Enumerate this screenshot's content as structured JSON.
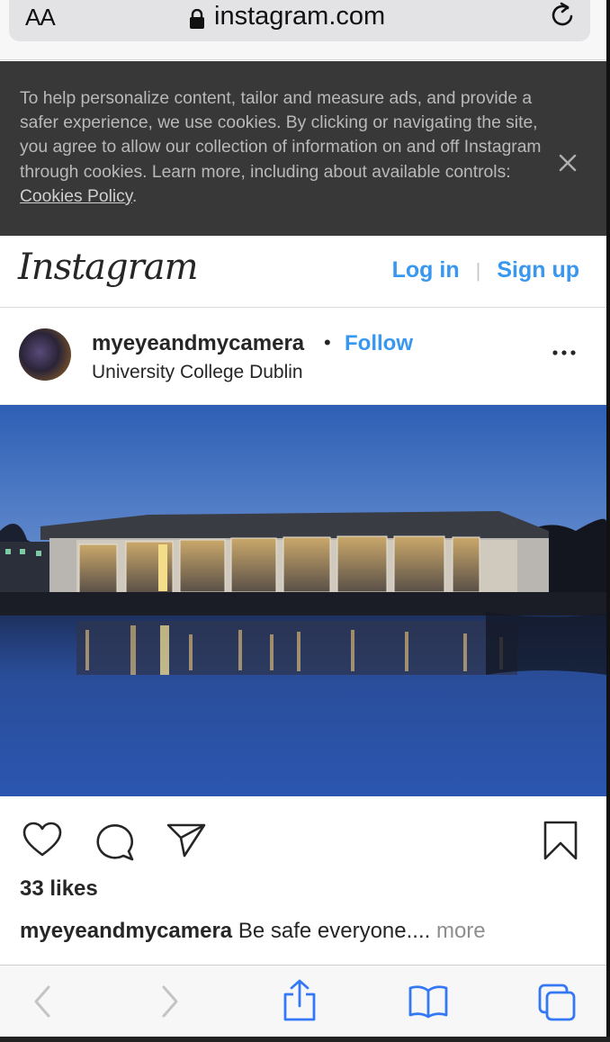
{
  "browser": {
    "text_size_label": "AA",
    "url": "instagram.com"
  },
  "cookie_banner": {
    "text": "To help personalize content, tailor and measure ads, and provide a safer experience, we use cookies. By clicking or navigating the site, you agree to allow our collection of information on and off Instagram through cookies. Learn more, including about available controls: ",
    "policy_link": "Cookies Policy",
    "suffix": "."
  },
  "header": {
    "logo": "Instagram",
    "login_label": "Log in",
    "separator": "|",
    "signup_label": "Sign up"
  },
  "post": {
    "username": "myeyeandmycamera",
    "dot": "•",
    "follow_label": "Follow",
    "location": "University College Dublin",
    "likes": "33 likes",
    "caption_user": "myeyeandmycamera",
    "caption_text": " Be safe everyone.... ",
    "caption_more": "more"
  },
  "colors": {
    "link_blue": "#3897f0",
    "cookie_bg": "#383838",
    "text_dark": "#262626"
  },
  "icons": [
    "lock-icon",
    "reload-icon",
    "close-icon",
    "more-options-icon",
    "heart-icon",
    "comment-icon",
    "share-icon",
    "bookmark-icon",
    "back-icon",
    "forward-icon",
    "share-sheet-icon",
    "bookmarks-icon",
    "tabs-icon"
  ]
}
